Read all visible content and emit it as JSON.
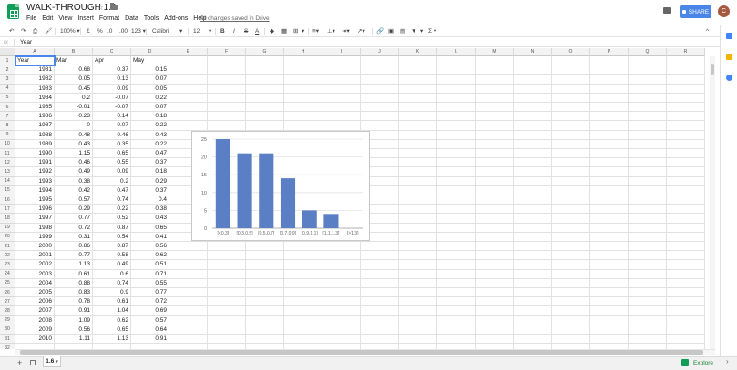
{
  "app": {
    "doc_title": "WALK-THROUGH 1.6",
    "saved_status": "All changes saved in Drive",
    "share_label": "SHARE",
    "avatar_initial": "C",
    "menu": [
      "File",
      "Edit",
      "View",
      "Insert",
      "Format",
      "Data",
      "Tools",
      "Add-ons",
      "Help"
    ]
  },
  "toolbar": {
    "zoom": "100%",
    "currency": "£",
    "percent": "%",
    "dec_less": ".0",
    "dec_more": ".00",
    "format_more": "123",
    "font": "Calibri",
    "font_size": "12",
    "bold": "B",
    "italic": "I",
    "strike": "S",
    "text_color": "A",
    "sum": "Σ"
  },
  "formula_bar": {
    "fx": "fx",
    "value": "Year"
  },
  "grid": {
    "columns": [
      "A",
      "B",
      "C",
      "D",
      "E",
      "F",
      "G",
      "H",
      "I",
      "J",
      "K",
      "L",
      "M",
      "N",
      "O",
      "P",
      "Q",
      "R"
    ],
    "headers": [
      "Year",
      "Mar",
      "Apr",
      "May"
    ],
    "rows": [
      [
        "1981",
        "0.68",
        "0.37",
        "0.15"
      ],
      [
        "1982",
        "0.05",
        "0.13",
        "0.07"
      ],
      [
        "1983",
        "0.45",
        "0.09",
        "0.05"
      ],
      [
        "1984",
        "0.2",
        "-0.07",
        "0.22"
      ],
      [
        "1985",
        "-0.01",
        "-0.07",
        "0.07"
      ],
      [
        "1986",
        "0.23",
        "0.14",
        "0.18"
      ],
      [
        "1987",
        "0",
        "0.07",
        "0.22"
      ],
      [
        "1988",
        "0.48",
        "0.46",
        "0.43"
      ],
      [
        "1989",
        "0.43",
        "0.35",
        "0.22"
      ],
      [
        "1990",
        "1.15",
        "0.65",
        "0.47"
      ],
      [
        "1991",
        "0.46",
        "0.55",
        "0.37"
      ],
      [
        "1992",
        "0.49",
        "0.09",
        "0.18"
      ],
      [
        "1993",
        "0.38",
        "0.2",
        "0.29"
      ],
      [
        "1994",
        "0.42",
        "0.47",
        "0.37"
      ],
      [
        "1995",
        "0.57",
        "0.74",
        "0.4"
      ],
      [
        "1996",
        "0.29",
        "0.22",
        "0.38"
      ],
      [
        "1997",
        "0.77",
        "0.52",
        "0.43"
      ],
      [
        "1998",
        "0.72",
        "0.87",
        "0.65"
      ],
      [
        "1999",
        "0.31",
        "0.54",
        "0.41"
      ],
      [
        "2000",
        "0.86",
        "0.87",
        "0.56"
      ],
      [
        "2001",
        "0.77",
        "0.58",
        "0.62"
      ],
      [
        "2002",
        "1.13",
        "0.49",
        "0.51"
      ],
      [
        "2003",
        "0.61",
        "0.6",
        "0.71"
      ],
      [
        "2004",
        "0.88",
        "0.74",
        "0.55"
      ],
      [
        "2005",
        "0.83",
        "0.9",
        "0.77"
      ],
      [
        "2006",
        "0.78",
        "0.61",
        "0.72"
      ],
      [
        "2007",
        "0.91",
        "1.04",
        "0.69"
      ],
      [
        "2008",
        "1.09",
        "0.62",
        "0.57"
      ],
      [
        "2009",
        "0.56",
        "0.65",
        "0.64"
      ],
      [
        "2010",
        "1.11",
        "1.13",
        "0.91"
      ]
    ]
  },
  "sheet_tab": "1.6",
  "explore_label": "Explore",
  "chart_data": {
    "type": "bar",
    "categories": [
      "[<0.3]",
      "[0.3,0.5]",
      "[0.5,0.7]",
      "[0.7,0.9]",
      "[0.9,1.1]",
      "[1.1,1.3]",
      "[>1.3]"
    ],
    "values": [
      25,
      21,
      21,
      14,
      5,
      4,
      0
    ],
    "yticks": [
      "0",
      "5",
      "10",
      "15",
      "20",
      "25"
    ],
    "ylim": [
      0,
      25
    ],
    "grid": true,
    "bar_color": "#5a7fc5"
  }
}
